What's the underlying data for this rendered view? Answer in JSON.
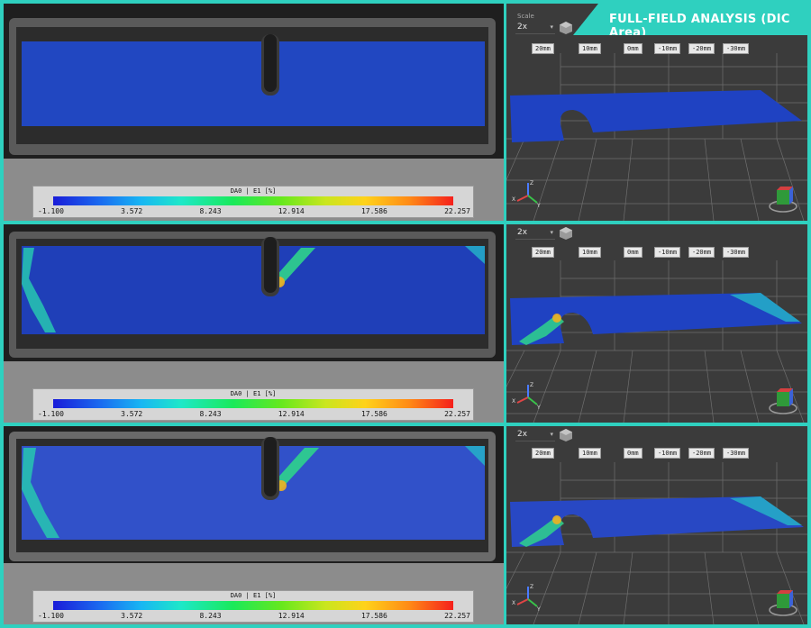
{
  "title": "FULL-FIELD ANALYSIS (DIC Area)",
  "legend": {
    "title": "DA0 | E1 [%]",
    "ticks": [
      "-1.100",
      "3.572",
      "8.243",
      "12.914",
      "17.586",
      "22.257"
    ]
  },
  "view3d": {
    "scale_label": "Scale",
    "scale_value": "2x",
    "ruler": [
      "20mm",
      "10mm",
      "0mm",
      "-10mm",
      "-20mm",
      "-30mm"
    ]
  },
  "icons": {
    "cube": "cube-icon",
    "axis": "axis-triad-icon",
    "navcube": "navigation-cube-icon",
    "dropdown": "chevron-down-icon"
  },
  "colors": {
    "accent": "#2fd0bf",
    "strain_low": "#1a1cd8",
    "strain_high": "#f5201c",
    "viewport_bg": "#3b3b3b"
  }
}
